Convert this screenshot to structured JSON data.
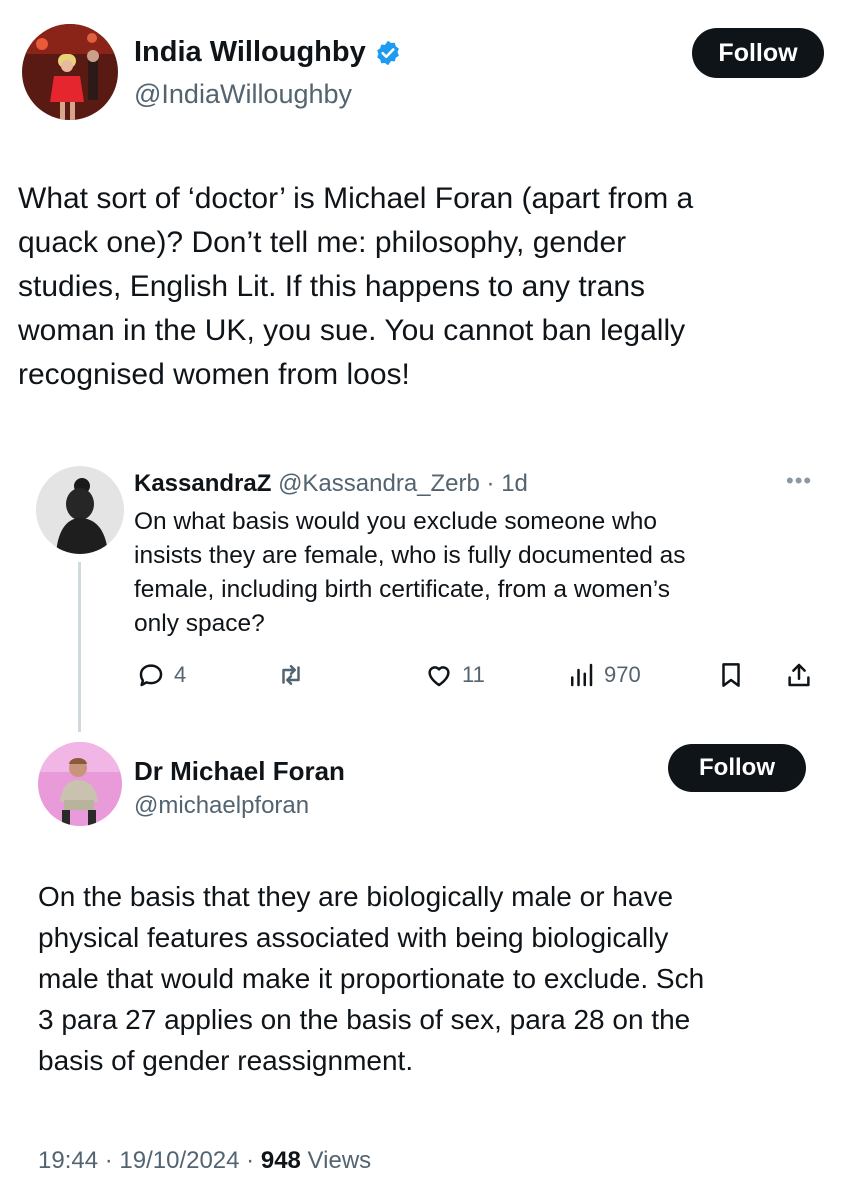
{
  "author": {
    "name": "India Willoughby",
    "handle": "@IndiaWilloughby",
    "follow_label": "Follow"
  },
  "tweet": {
    "text": "What sort of ‘doctor’ is Michael Foran (apart from a\nquack one)? Don’t tell me: philosophy, gender\nstudies, English Lit. If this happens to any trans\nwoman in the UK, you sue. You cannot ban legally\nrecognised women from loos!"
  },
  "quoted": {
    "name": "KassandraZ",
    "meta": "@Kassandra_Zerb · 1d",
    "text": "On what basis would you exclude someone who\ninsists they are female, who is fully documented as\nfemale, including birth certificate, from a women’s\nonly space?",
    "reply_count": "4",
    "like_count": "11",
    "view_count": "970"
  },
  "reply": {
    "name": "Dr Michael Foran",
    "handle": "@michaelpforan",
    "follow_label": "Follow",
    "text": "On the basis that they are biologically male or have\nphysical features associated with being biologically\nmale that would make it proportionate to exclude. Sch\n3 para 27 applies on the basis of sex, para 28 on the\nbasis of gender reassignment.",
    "timestamp": "19:44 · 19/10/2024 · ",
    "views_count": "948",
    "views_label": " Views"
  },
  "colors": {
    "verified": "#1d9bf0",
    "text": "#0f1419",
    "secondary": "#536471",
    "button": "#0f1419"
  }
}
